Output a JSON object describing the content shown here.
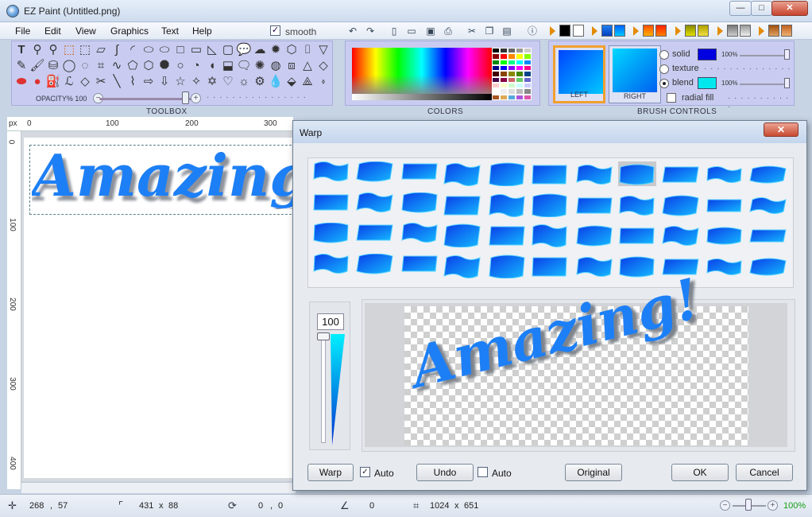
{
  "window": {
    "title": "EZ Paint (Untitled.png)",
    "min": "—",
    "max": "□",
    "close": "✕"
  },
  "menu": [
    "File",
    "Edit",
    "View",
    "Graphics",
    "Text",
    "Help"
  ],
  "toolbar": {
    "smooth_label": "smooth",
    "smooth_checked": "✓"
  },
  "toolbox": {
    "label": "TOOLBOX",
    "opacity_label": "OPACITY% 100"
  },
  "colors": {
    "label": "COLORS"
  },
  "brush": {
    "label": "BRUSH CONTROLS",
    "left_label": "LEFT",
    "right_label": "RIGHT",
    "solid_label": "solid",
    "texture_label": "texture",
    "blend_label": "blend",
    "radial_label": "radial fill",
    "solid_pct": "100%",
    "blend_pct": "100%",
    "solid_color": "#0000e0",
    "blend_color": "#00e8ee",
    "selected": "blend"
  },
  "rulers": {
    "unit": "px",
    "h_ticks": [
      "0",
      "100",
      "200",
      "300"
    ],
    "v_ticks": [
      "0",
      "100",
      "200",
      "300",
      "400"
    ]
  },
  "canvas": {
    "text": "Amazing!",
    "text_color": "#1d7ff5"
  },
  "status": {
    "cursor_x": "268",
    "cursor_y": "57",
    "sel_w": "431",
    "sel_h": "88",
    "offset_x": "0",
    "offset_y": "0",
    "angle": "0",
    "img_w": "1024",
    "img_h": "651",
    "zoom": "100%",
    "sep_comma": ",",
    "sep_x": "x"
  },
  "warp": {
    "title": "Warp",
    "slider_value": "100",
    "preview_text": "Amazing!",
    "buttons": {
      "warp": "Warp",
      "undo": "Undo",
      "original": "Original",
      "ok": "OK",
      "cancel": "Cancel"
    },
    "auto1_label": "Auto",
    "auto1_checked": "✓",
    "auto2_label": "Auto",
    "selected_shape": 7
  }
}
